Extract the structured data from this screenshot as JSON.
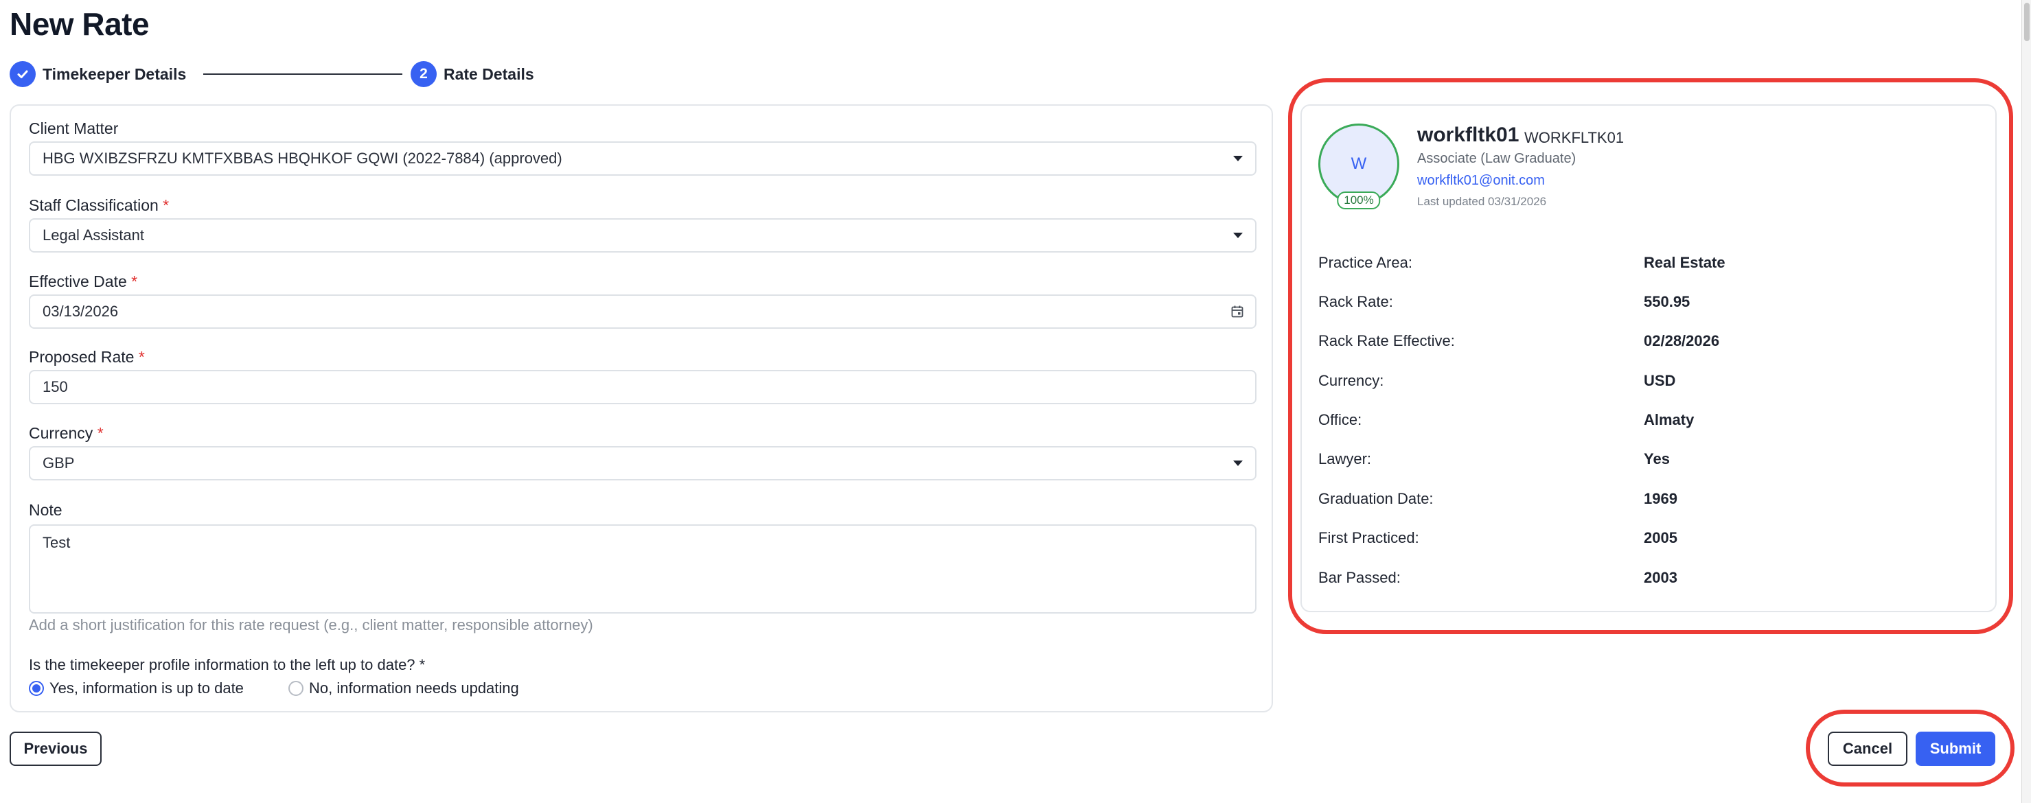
{
  "page": {
    "title": "New Rate"
  },
  "stepper": {
    "steps": [
      {
        "label": "Timekeeper Details",
        "state": "complete",
        "icon": "check-icon"
      },
      {
        "label": "Rate Details",
        "number": "2",
        "state": "active"
      }
    ]
  },
  "form": {
    "client_matter": {
      "label": "Client Matter",
      "value": "HBG WXIBZSFRZU KMTFXBBAS HBQHKOF GQWI (2022-7884) (approved)"
    },
    "staff_classification": {
      "label": "Staff Classification",
      "required_mark": "*",
      "value": "Legal Assistant"
    },
    "effective_date": {
      "label": "Effective Date",
      "required_mark": "*",
      "value": "03/13/2026"
    },
    "proposed_rate": {
      "label": "Proposed Rate",
      "required_mark": "*",
      "value": "150"
    },
    "currency": {
      "label": "Currency",
      "required_mark": "*",
      "value": "GBP"
    },
    "note": {
      "label": "Note",
      "value": "Test",
      "hint": "Add a short justification for this rate request (e.g., client matter, responsible attorney)"
    },
    "question": {
      "label": "Is the timekeeper profile information to the left up to date? *",
      "options": [
        {
          "label": "Yes, information is up to date",
          "selected": true
        },
        {
          "label": "No, information needs updating",
          "selected": false
        }
      ]
    }
  },
  "profile": {
    "avatar_initial": "W",
    "completeness": "100%",
    "name": "workfltk01",
    "code": "WORKFLTK01",
    "title": "Associate (Law Graduate)",
    "email": "workfltk01@onit.com",
    "last_updated": "Last updated 03/31/2026",
    "details": [
      {
        "label": "Practice Area:",
        "value": "Real Estate"
      },
      {
        "label": "Rack Rate:",
        "value": "550.95"
      },
      {
        "label": "Rack Rate Effective:",
        "value": "02/28/2026"
      },
      {
        "label": "Currency:",
        "value": "USD"
      },
      {
        "label": "Office:",
        "value": "Almaty"
      },
      {
        "label": "Lawyer:",
        "value": "Yes"
      },
      {
        "label": "Graduation Date:",
        "value": "1969"
      },
      {
        "label": "First Practiced:",
        "value": "2005"
      },
      {
        "label": "Bar Passed:",
        "value": "2003"
      }
    ]
  },
  "actions": {
    "previous": "Previous",
    "cancel": "Cancel",
    "submit": "Submit"
  },
  "colors": {
    "accent": "#3761f2",
    "highlight": "#ec3b35",
    "required": "#e0302f",
    "success": "#3aaa58"
  }
}
